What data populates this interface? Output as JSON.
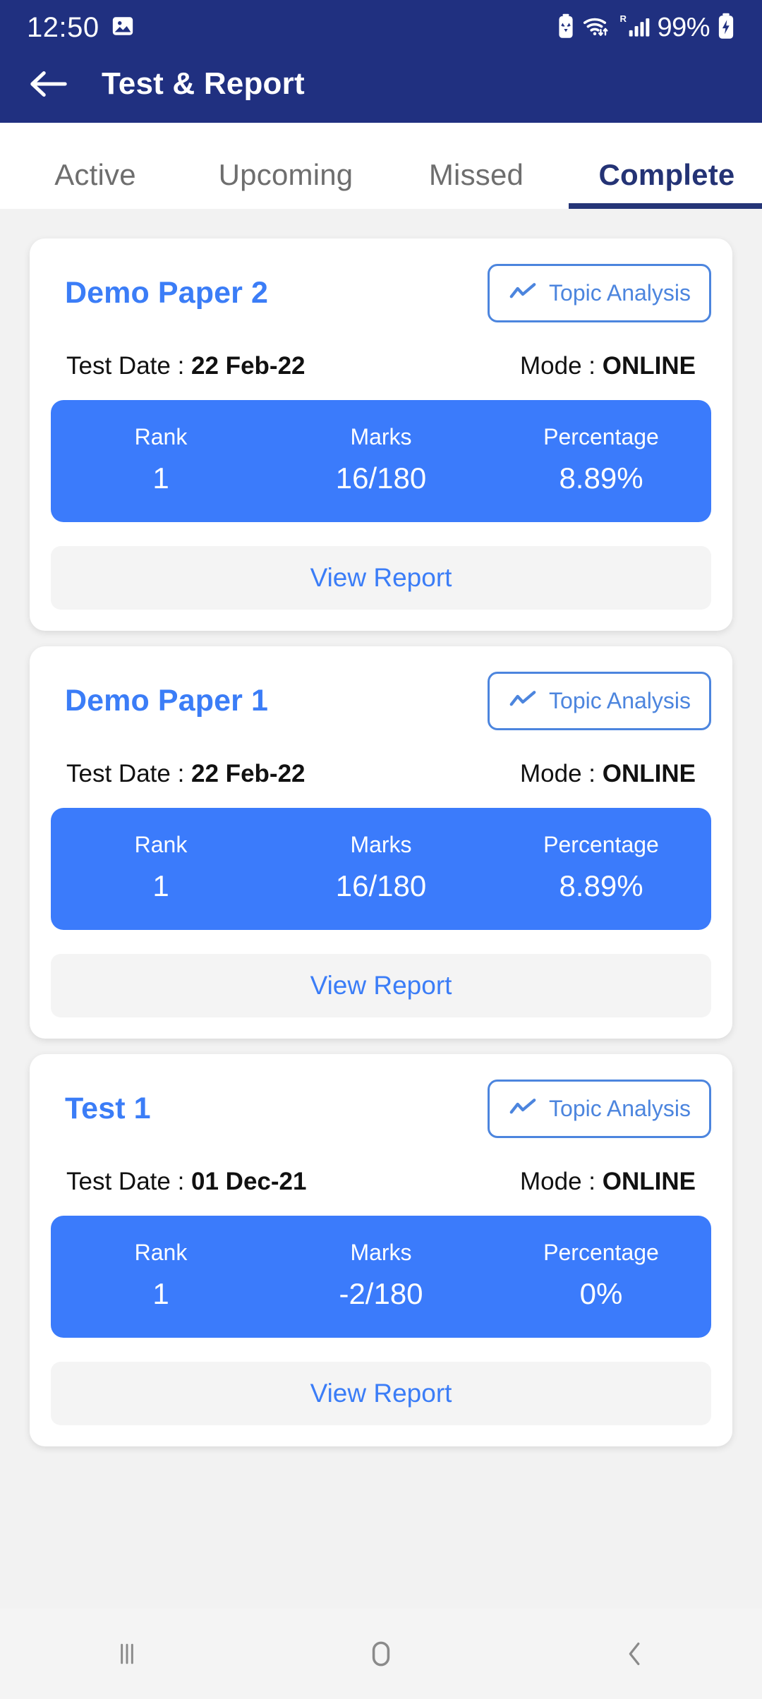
{
  "status_bar": {
    "time": "12:50",
    "battery_percent": "99%",
    "icons": [
      "photo-notification-icon",
      "battery-saver-icon",
      "wifi-icon",
      "roaming-signal-icon",
      "charging-battery-icon"
    ]
  },
  "app_bar": {
    "title": "Test & Report",
    "back_icon": "back-arrow-icon"
  },
  "tabs": [
    {
      "label": "Active",
      "active": false
    },
    {
      "label": "Upcoming",
      "active": false
    },
    {
      "label": "Missed",
      "active": false
    },
    {
      "label": "Complete",
      "active": true
    }
  ],
  "labels": {
    "test_date_prefix": "Test Date : ",
    "mode_prefix": "Mode : ",
    "rank": "Rank",
    "marks": "Marks",
    "percentage": "Percentage",
    "topic_analysis": "Topic Analysis",
    "view_report": "View Report"
  },
  "cards": [
    {
      "title": "Demo Paper 2",
      "test_date": "22 Feb-22",
      "mode": "ONLINE",
      "rank": "1",
      "marks": "16/180",
      "percentage": "8.89%"
    },
    {
      "title": "Demo Paper 1",
      "test_date": "22 Feb-22",
      "mode": "ONLINE",
      "rank": "1",
      "marks": "16/180",
      "percentage": "8.89%"
    },
    {
      "title": "Test 1",
      "test_date": "01 Dec-21",
      "mode": "ONLINE",
      "rank": "1",
      "marks": "-2/180",
      "percentage": "0%"
    }
  ],
  "nav_bar": {
    "recents": "recents-icon",
    "home": "home-icon",
    "back": "back-chevron-icon"
  },
  "colors": {
    "header_navy": "#203080",
    "tab_active": "#243375",
    "accent_blue": "#3B7DF7",
    "stats_blue": "#3B7BFB",
    "page_bg": "#f2f2f2"
  }
}
